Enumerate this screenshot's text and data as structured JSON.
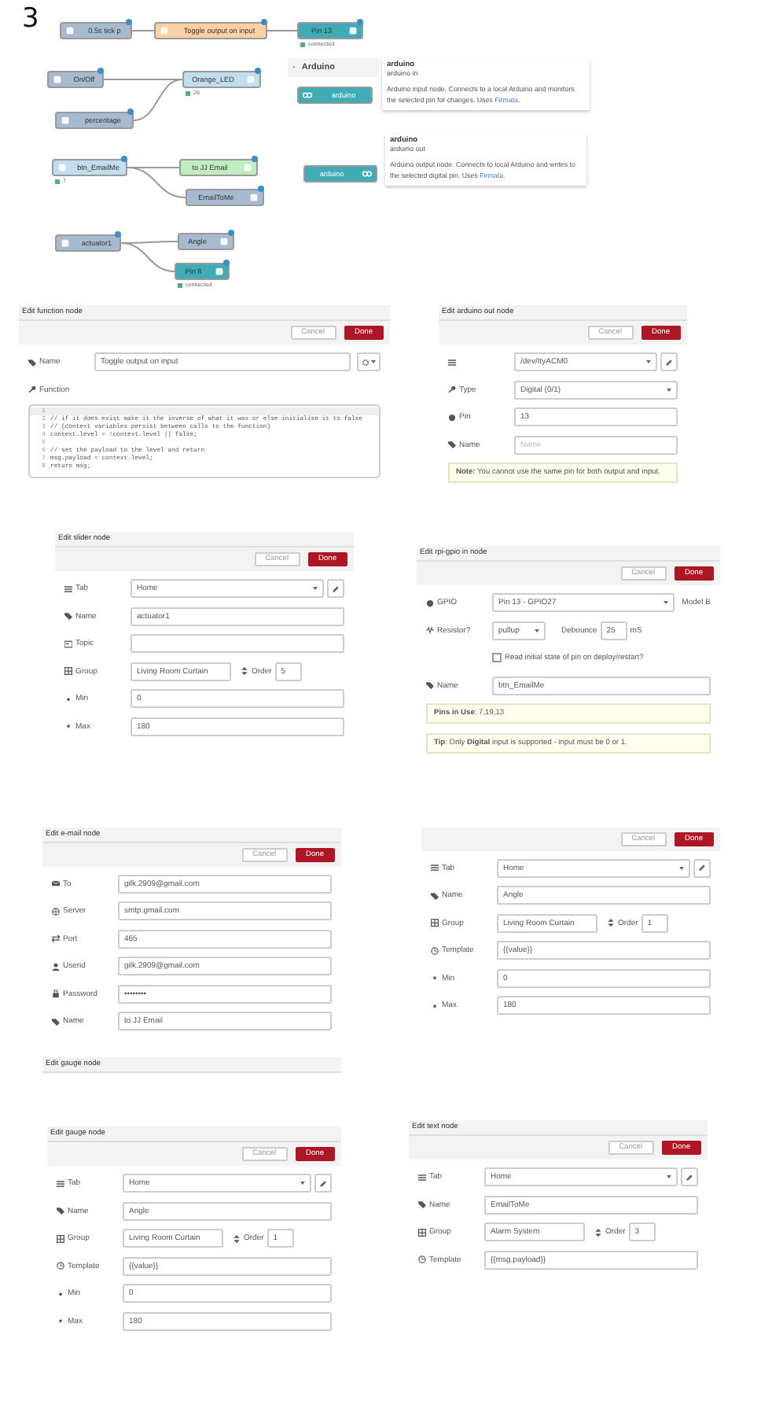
{
  "flow": {
    "step": "3",
    "nodes": [
      {
        "label": "0.5s tick p",
        "color": "#a6bbcf",
        "kind": "input",
        "changed": true
      },
      {
        "label": "Toggle output on input",
        "color": "#fdd0a2",
        "kind": "input",
        "changed": true
      },
      {
        "label": "Pin 13",
        "color": "#3fadb5",
        "kind": "output",
        "changed": true,
        "status": "connected"
      },
      {
        "label": "On/Off",
        "color": "#a6bbcf",
        "kind": "input",
        "changed": true
      },
      {
        "label": "Orange_LED",
        "color": "#c0deed",
        "kind": "output",
        "changed": true,
        "status": "26"
      },
      {
        "label": "percentage",
        "color": "#a6bbcf",
        "kind": "input",
        "changed": true
      },
      {
        "label": "btn_EmailMe",
        "color": "#c0deed",
        "kind": "input",
        "changed": true,
        "status": "7"
      },
      {
        "label": "to JJ Email",
        "color": "#c0edc0",
        "kind": "output",
        "changed": true
      },
      {
        "label": "EmailToMe",
        "color": "#a6bbcf",
        "kind": "output",
        "changed": true
      },
      {
        "label": "actuator1",
        "color": "#a6bbcf",
        "kind": "input",
        "changed": true
      },
      {
        "label": "Angle",
        "color": "#a6bbcf",
        "kind": "output",
        "changed": true
      },
      {
        "label": "Pin 8",
        "color": "#3fadb5",
        "kind": "output",
        "changed": true,
        "status": "connected"
      }
    ]
  },
  "palette": {
    "category": "Arduino",
    "caret": "-",
    "expanded": true,
    "nodes": [
      {
        "label": "arduino",
        "kind": "input"
      },
      {
        "label": "arduino",
        "kind": "output"
      }
    ]
  },
  "tooltips": [
    {
      "title": "arduino",
      "subtitle": "arduino in",
      "text": "Arduino input node. Connects to a local Arduino and monitors the selected pin for changes. Uses ",
      "link": "Firmata",
      "after": "."
    },
    {
      "title": "arduino",
      "subtitle": "arduino out",
      "text": "Arduino output node. Connects to local Arduino and writes to the selected digital pin. Uses ",
      "link": "Firmata",
      "after": "."
    }
  ],
  "dialogs": [
    {
      "title": "Edit function node",
      "buttons": [
        {
          "label": "Cancel",
          "kind": "secondary"
        },
        {
          "label": "Done",
          "kind": "primary"
        }
      ],
      "fields": [
        {
          "icon": {
            "kind": "name"
          },
          "label": "Name",
          "kind": "name_icon",
          "value": "Toggle output on input"
        },
        {
          "icon": {
            "kind": "function"
          },
          "label": "Function",
          "kind": "code",
          "lines": [
            {
              "number": "1"
            },
            {
              "number": "2",
              "code": "// if it does exist make it the inverse of what it was or else initialise it to false"
            },
            {
              "number": "3",
              "code": "// (context variables persist between calls to the function)"
            },
            {
              "number": "4",
              "code": "context.level = !context.level || false;"
            },
            {
              "number": "5"
            },
            {
              "number": "6",
              "code": "// set the payload to the level and return"
            },
            {
              "number": "7",
              "code": "msg.payload = context.level;"
            },
            {
              "number": "8",
              "code": "return msg;"
            }
          ]
        }
      ]
    },
    {
      "title": "Edit arduino out node",
      "buttons": [
        {
          "label": "Cancel",
          "kind": "secondary"
        },
        {
          "label": "Done",
          "kind": "primary"
        }
      ],
      "fields": [
        {
          "icon": {
            "kind": "serial"
          },
          "kind": "select",
          "value": "/dev/ttyACM0",
          "edit": true
        },
        {
          "icon": {
            "kind": "type"
          },
          "label": "Type",
          "kind": "select",
          "value": "Digital (0/1)"
        },
        {
          "icon": {
            "kind": "pin"
          },
          "label": "Pin",
          "kind": "input",
          "value": "13"
        },
        {
          "icon": {
            "kind": "name"
          },
          "label": "Name",
          "kind": "input",
          "placeholder": "Name"
        },
        {
          "kind": "note",
          "text": "**Note:** You cannot use the same pin for both output and input."
        }
      ]
    },
    {
      "title": "Edit slider node",
      "buttons": [
        {
          "label": "Cancel",
          "kind": "secondary"
        },
        {
          "label": "Done",
          "kind": "primary"
        }
      ],
      "fields": [
        {
          "icon": {
            "kind": "tab"
          },
          "label": "Tab",
          "kind": "select",
          "value": "Home",
          "edit": true
        },
        {
          "icon": {
            "kind": "name"
          },
          "label": "Name",
          "kind": "input",
          "value": "actuator1"
        },
        {
          "icon": {
            "kind": "topic"
          },
          "label": "Topic",
          "kind": "input"
        },
        {
          "icon": {
            "kind": "group"
          },
          "label": "Group",
          "kind": "group",
          "value": "Living Room Curtain",
          "order_label": "Order",
          "order_value": "5"
        },
        {
          "icon": {
            "kind": "min"
          },
          "label": "Min",
          "kind": "input",
          "value": "0"
        },
        {
          "icon": {
            "kind": "max"
          },
          "label": "Max",
          "kind": "input",
          "value": "180"
        }
      ]
    },
    {
      "title": "Edit rpi-gpio in node",
      "buttons": [
        {
          "label": "Cancel",
          "kind": "secondary"
        },
        {
          "label": "Done",
          "kind": "primary"
        }
      ],
      "fields": [
        {
          "icon": {
            "kind": "gpio"
          },
          "label": "GPIO",
          "kind": "select",
          "value": "Pin 13 - GPIO27",
          "suffix": "Model B"
        },
        {
          "icon": {
            "kind": "resistor"
          },
          "label": "Resistor?",
          "kind": "resistor",
          "value": "pullup",
          "debounce_label": "Debounce",
          "debounce_value": "25",
          "unit": "mS"
        },
        {
          "kind": "checkbox",
          "label": "Read initial state of pin on deploy/restart?",
          "checked": false
        },
        {
          "icon": {
            "kind": "name"
          },
          "label": "Name",
          "kind": "input",
          "value": "btn_EmailMe"
        },
        {
          "kind": "note",
          "text": "**Pins in Use**: 7,19,13"
        },
        {
          "kind": "note",
          "text": "**Tip**: Only **Digital** input is supported - input must be 0 or 1."
        }
      ]
    },
    {
      "title": "Edit e-mail node",
      "buttons": [
        {
          "label": "Cancel",
          "kind": "secondary"
        },
        {
          "label": "Done",
          "kind": "primary"
        }
      ],
      "fields": [
        {
          "icon": {
            "kind": "to"
          },
          "label": "To",
          "kind": "input",
          "value": "gilk.2909@gmail.com"
        },
        {
          "icon": {
            "kind": "server"
          },
          "label": "Server",
          "kind": "input",
          "value": "smtp.gmail.com"
        },
        {
          "icon": {
            "kind": "port"
          },
          "label": "Port",
          "kind": "input",
          "value": "465"
        },
        {
          "icon": {
            "kind": "user"
          },
          "label": "Userid",
          "kind": "input",
          "value": "gilk.2909@gmail.com"
        },
        {
          "icon": {
            "kind": "password"
          },
          "label": "Password",
          "kind": "input",
          "value": "••••••••"
        },
        {
          "icon": {
            "kind": "name"
          },
          "label": "Name",
          "kind": "input",
          "value": "to JJ Email"
        }
      ]
    },
    {
      "title": "Edit gauge node"
    },
    {
      "buttons": [
        {
          "label": "Cancel",
          "kind": "secondary"
        },
        {
          "label": "Done",
          "kind": "primary"
        }
      ],
      "fields": [
        {
          "icon": {
            "kind": "tab"
          },
          "label": "Tab",
          "kind": "select",
          "value": "Home",
          "edit": true
        },
        {
          "icon": {
            "kind": "name"
          },
          "label": "Name",
          "kind": "input",
          "value": "Angle"
        },
        {
          "icon": {
            "kind": "group"
          },
          "label": "Group",
          "kind": "group",
          "value": "Living Room Curtain",
          "order_label": "Order",
          "order_value": "1"
        },
        {
          "icon": {
            "kind": "template"
          },
          "label": "Template",
          "kind": "input",
          "value": "{{value}}"
        },
        {
          "icon": {
            "kind": "min"
          },
          "label": "Min",
          "kind": "input",
          "value": "0"
        },
        {
          "icon": {
            "kind": "max"
          },
          "label": "Max",
          "kind": "input",
          "value": "180"
        }
      ]
    },
    {
      "title": "Edit gauge node",
      "buttons": [
        {
          "label": "Cancel",
          "kind": "secondary"
        },
        {
          "label": "Done",
          "kind": "primary"
        }
      ],
      "fields": [
        {
          "icon": {
            "kind": "tab"
          },
          "label": "Tab",
          "kind": "select",
          "value": "Home",
          "edit": true
        },
        {
          "icon": {
            "kind": "name"
          },
          "label": "Name",
          "kind": "input",
          "value": "Angle"
        },
        {
          "icon": {
            "kind": "group"
          },
          "label": "Group",
          "kind": "group",
          "value": "Living Room Curtain",
          "order_label": "Order",
          "order_value": "1"
        },
        {
          "icon": {
            "kind": "template"
          },
          "label": "Template",
          "kind": "input",
          "value": "{{value}}"
        },
        {
          "icon": {
            "kind": "min"
          },
          "label": "Min",
          "kind": "input",
          "value": "0"
        },
        {
          "icon": {
            "kind": "max"
          },
          "label": "Max",
          "kind": "input",
          "value": "180"
        }
      ]
    },
    {
      "title": "Edit text node",
      "buttons": [
        {
          "label": "Cancel",
          "kind": "secondary"
        },
        {
          "label": "Done",
          "kind": "primary"
        }
      ],
      "fields": [
        {
          "icon": {
            "kind": "tab"
          },
          "label": "Tab",
          "kind": "select",
          "value": "Home",
          "edit": true
        },
        {
          "icon": {
            "kind": "name"
          },
          "label": "Name",
          "kind": "input",
          "value": "EmailToMe"
        },
        {
          "icon": {
            "kind": "group"
          },
          "label": "Group",
          "kind": "group",
          "value": "Alarm System",
          "order_label": "Order",
          "order_value": "3"
        },
        {
          "icon": {
            "kind": "template"
          },
          "label": "Template",
          "kind": "input",
          "value": "{{msg.payload}}"
        }
      ]
    }
  ]
}
